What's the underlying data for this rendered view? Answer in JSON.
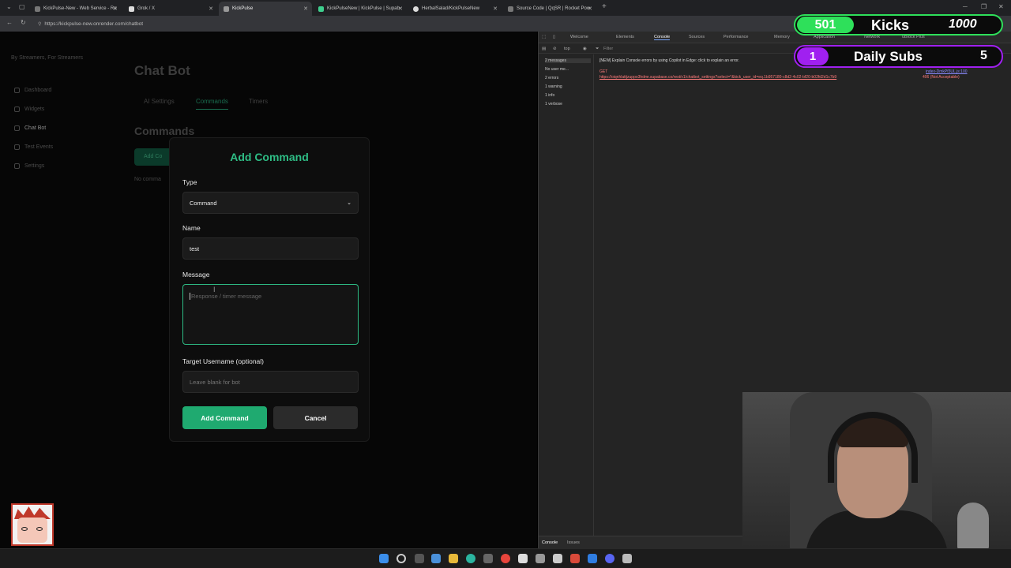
{
  "browser": {
    "tabs": [
      {
        "label": "KickPulse-New - Web Service - Re",
        "active": false
      },
      {
        "label": "Grok / X",
        "active": false
      },
      {
        "label": "KickPulse",
        "active": true
      },
      {
        "label": "KickPulseNew | KickPulse | Supab",
        "active": false
      },
      {
        "label": "HerbalSalad/KickPulseNew",
        "active": false
      },
      {
        "label": "Source Code | QqSR | Rocket Pow",
        "active": false
      }
    ],
    "url": "https://kickpulse-new.onrender.com/chatbot",
    "new_tab": "+"
  },
  "page": {
    "brand": "By Streamers, For Streamers",
    "nav": [
      "Dashboard",
      "Widgets",
      "Chat Bot",
      "Test Events",
      "Settings"
    ],
    "title": "Chat Bot",
    "tabs": [
      "AI Settings",
      "Commands",
      "Timers"
    ],
    "commands_heading": "Commands",
    "add_command_bg": "Add Co",
    "no_commands": "No comma"
  },
  "modal": {
    "title": "Add Command",
    "type_label": "Type",
    "type_value": "Command",
    "name_label": "Name",
    "name_value": "test",
    "message_label": "Message",
    "message_placeholder": "Response / timer message",
    "target_label": "Target Username (optional)",
    "target_placeholder": "Leave blank for bot",
    "add_button": "Add Command",
    "cancel_button": "Cancel"
  },
  "devtools": {
    "tabs": [
      "Welcome",
      "Elements",
      "Console",
      "Sources",
      "Performance",
      "Memory",
      "Application",
      "Network",
      "uBlock Plus"
    ],
    "context": "top",
    "filter_placeholder": "Filter",
    "categories": [
      "2 messages",
      "No user me...",
      "2 errors",
      "1 warning",
      "1 info",
      "1 verbose"
    ],
    "console_tip": "[NEW] Explain Console errors by using Copilot in Edge: click   to explain an error.",
    "error_method": "GET",
    "error_url": "https://oiqnhlattjzuppo3hdmr.supabase.co/rest/v1/chatbot_settings?select=*&kick_user_id=eq.1b957180-c8d2-4c02-bf20-b02fd2d1c7b9",
    "error_status": "406 (Not Acceptable)",
    "error_source": "index-DmkPf3UL.js:100",
    "drawer_tabs": [
      "Console",
      "Issues"
    ]
  },
  "overlay": {
    "kicks_count": "501",
    "kicks_label": "Kicks",
    "kicks_goal": "1000",
    "subs_count": "1",
    "subs_label": "Daily Subs",
    "subs_goal": "5"
  },
  "colors": {
    "accent_green": "#2ebd85",
    "kicks_green": "#2ee05a",
    "subs_purple": "#a020f0"
  }
}
